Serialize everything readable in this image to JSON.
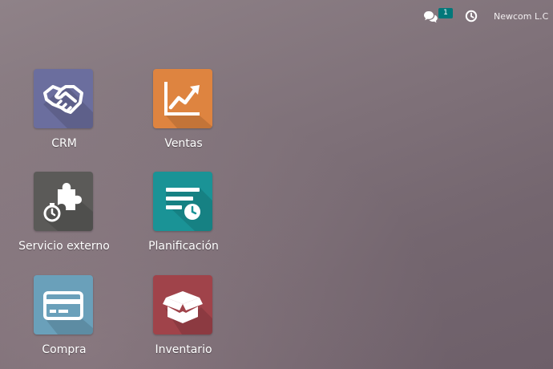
{
  "topbar": {
    "messages_icon": "chat-bubbles-icon",
    "messages_count": "1",
    "activity_icon": "clock-icon",
    "company_name": "Newcom L.C"
  },
  "apps": [
    {
      "label": "CRM",
      "icon": "handshake-icon",
      "color": "#6b6e9e"
    },
    {
      "label": "Ventas",
      "icon": "trend-chart-icon",
      "color": "#de8440"
    },
    {
      "label": "Servicio externo",
      "icon": "puzzle-stopwatch-icon",
      "color": "#5b5a58"
    },
    {
      "label": "Planificación",
      "icon": "planning-list-clock-icon",
      "color": "#1a9396"
    },
    {
      "label": "Compra",
      "icon": "credit-card-icon",
      "color": "#6aa0ba"
    },
    {
      "label": "Inventario",
      "icon": "open-box-icon",
      "color": "#a0434a"
    }
  ]
}
